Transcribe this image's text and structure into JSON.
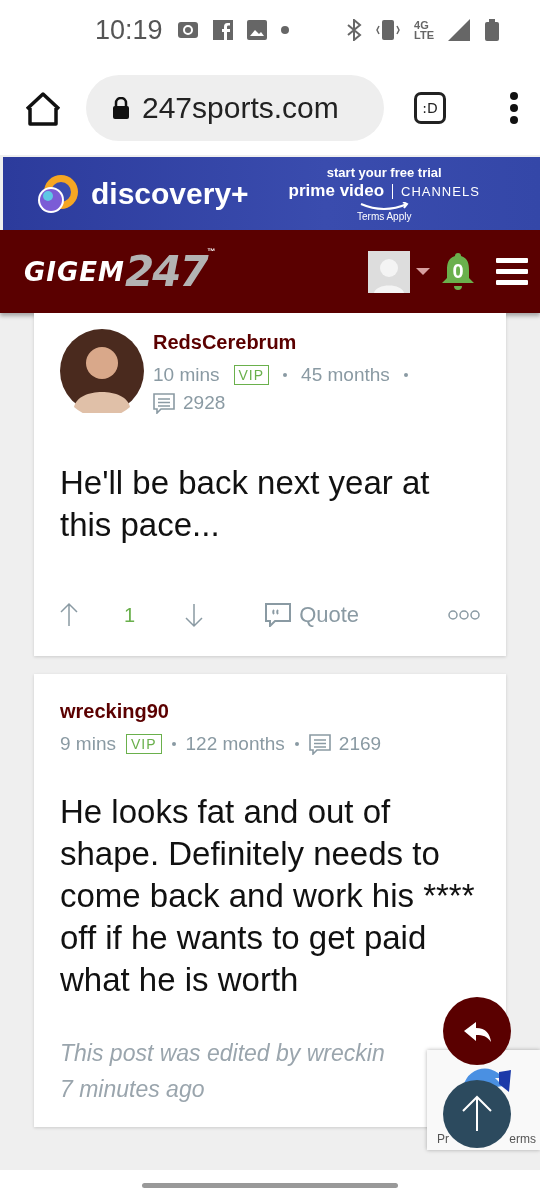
{
  "status_bar": {
    "time": "10:19",
    "network": "4G LTE"
  },
  "browser": {
    "url": "247sports.com",
    "tab_button": ":D"
  },
  "ad": {
    "brand": "discovery+",
    "tagline": "start your free trial",
    "partner": "prime video",
    "channels": "CHANNELS",
    "terms": "Terms Apply"
  },
  "site_header": {
    "logo_word": "GIGEM",
    "logo_number": "247",
    "trademark": "™",
    "notifications": "0"
  },
  "posts": [
    {
      "author": "RedsCerebrum",
      "has_avatar": true,
      "time": "10 mins",
      "badge": "VIP",
      "tenure": "45 months",
      "post_count": "2928",
      "body": "He'll be back next year at this pace...",
      "upvotes": "1",
      "quote": "Quote"
    },
    {
      "author": "wrecking90",
      "has_avatar": false,
      "time": "9 mins",
      "badge": "VIP",
      "tenure": "122 months",
      "post_count": "2169",
      "body": "He looks fat and out of shape. Definitely needs to come back and work his **** off if he wants to get paid what he is worth",
      "edit_note": [
        "This post was edited by wreckin",
        "7 minutes ago"
      ]
    }
  ],
  "recaptcha": {
    "left_text": "Pr",
    "right_text": "erms"
  }
}
